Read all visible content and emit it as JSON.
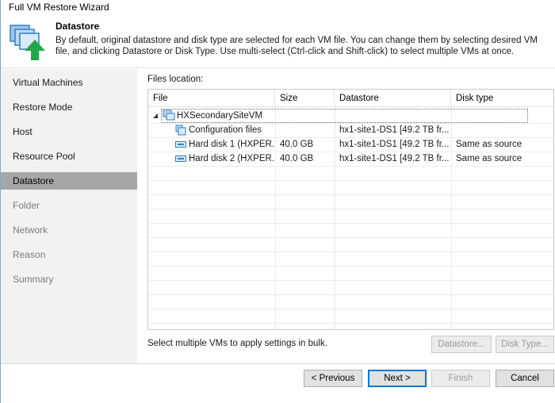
{
  "window": {
    "title": "Full VM Restore Wizard"
  },
  "header": {
    "title": "Datastore",
    "description": "By default, original datastore and disk type are selected for each VM file. You can change them by selecting desired VM file, and clicking Datastore or Disk Type. Use multi-select (Ctrl-click and Shift-click) to select multiple VMs at once.",
    "icon": "vm-restore-icon"
  },
  "sidebar": {
    "items": [
      {
        "label": "Virtual Machines",
        "state": "done"
      },
      {
        "label": "Restore Mode",
        "state": "done"
      },
      {
        "label": "Host",
        "state": "done"
      },
      {
        "label": "Resource Pool",
        "state": "done"
      },
      {
        "label": "Datastore",
        "state": "active"
      },
      {
        "label": "Folder",
        "state": "disabled"
      },
      {
        "label": "Network",
        "state": "disabled"
      },
      {
        "label": "Reason",
        "state": "disabled"
      },
      {
        "label": "Summary",
        "state": "disabled"
      }
    ]
  },
  "content": {
    "files_location_label": "Files location:",
    "columns": [
      "File",
      "Size",
      "Datastore",
      "Disk type"
    ],
    "rows": [
      {
        "file": "HXSecondarySiteVM",
        "size": "",
        "datastore": "",
        "disk_type": "",
        "icon": "vm-icon",
        "expanded": true
      },
      {
        "file": "Configuration files",
        "size": "",
        "datastore": "hx1-site1-DS1 [49.2 TB fr...",
        "disk_type": "",
        "icon": "config-files-icon"
      },
      {
        "file": "Hard disk 1 (HXPER...",
        "size": "40.0 GB",
        "datastore": "hx1-site1-DS1 [49.2 TB fr...",
        "disk_type": "Same as source",
        "icon": "hard-disk-icon"
      },
      {
        "file": "Hard disk 2 (HXPER...",
        "size": "40.0 GB",
        "datastore": "hx1-site1-DS1 [49.2 TB fr...",
        "disk_type": "Same as source",
        "icon": "hard-disk-icon"
      }
    ],
    "bulk_hint": "Select multiple VMs to apply settings in bulk.",
    "datastore_button": "Datastore...",
    "disk_type_button": "Disk Type..."
  },
  "footer": {
    "previous": "< Previous",
    "next": "Next >",
    "finish": "Finish",
    "cancel": "Cancel"
  },
  "colors": {
    "sidebar_bg": "#f2f2f2",
    "active_item_bg": "#a6a6a6",
    "primary_border": "#0078d7",
    "icon_blue": "#2f7fc1",
    "arrow_green": "#22a84a"
  }
}
